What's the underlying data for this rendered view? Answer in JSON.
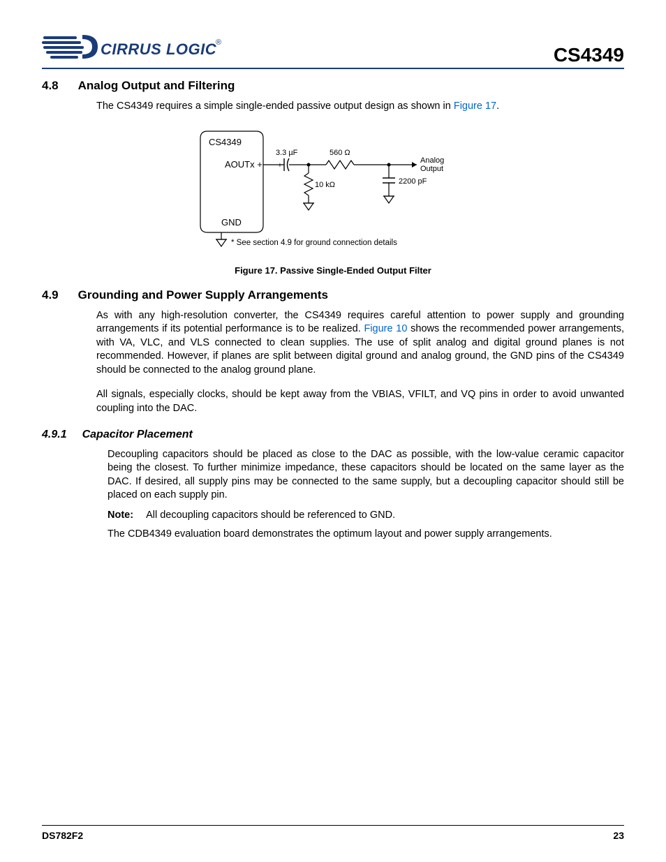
{
  "header": {
    "logo_text": "CIRRUS LOGIC",
    "product_id": "CS4349"
  },
  "sec48": {
    "num": "4.8",
    "title": "Analog Output and Filtering",
    "p1_a": "The CS4349 requires a simple single-ended passive output design as shown in ",
    "p1_link": "Figure 17",
    "p1_b": "."
  },
  "figure17": {
    "chip_label": "CS4349",
    "pin_out": "AOUTx +",
    "pin_gnd": "GND",
    "cap1": "3.3 µF",
    "cap1_pol": "+",
    "res1": "560 Ω",
    "res2": "10 kΩ",
    "cap2": "2200 pF",
    "out_label1": "Analog",
    "out_label2": "Output",
    "footnote": "* See section 4.9 for ground connection details",
    "caption": "Figure 17.  Passive Single-Ended Output Filter"
  },
  "sec49": {
    "num": "4.9",
    "title": "Grounding and Power Supply Arrangements",
    "p1_a": "As with any high-resolution converter, the CS4349 requires careful attention to power supply and grounding arrangements if its potential performance is to be realized. ",
    "p1_link": "Figure 10",
    "p1_b": " shows the recommended power arrangements, with VA, VLC, and VLS connected to clean supplies. The use of split analog and digital ground planes is not recommended. However, if planes are split between digital ground and analog ground, the GND pins of the CS4349 should be connected to the analog ground plane.",
    "p2": "All signals, especially clocks, should be kept away from the VBIAS, VFILT, and VQ pins in order to avoid unwanted coupling into the DAC."
  },
  "sec491": {
    "num": "4.9.1",
    "title": "Capacitor Placement",
    "p1": "Decoupling capacitors should be placed as close to the DAC as possible, with the low-value ceramic capacitor being the closest. To further minimize impedance, these capacitors should be located on the same layer as the DAC. If desired, all supply pins may be connected to the same supply, but a decoupling capacitor should still be placed on each supply pin.",
    "note_label": "Note:",
    "note_text": "All decoupling capacitors should be referenced to GND.",
    "p2": "The CDB4349 evaluation board demonstrates the optimum layout and power supply arrangements."
  },
  "footer": {
    "left": "DS782F2",
    "right": "23"
  }
}
